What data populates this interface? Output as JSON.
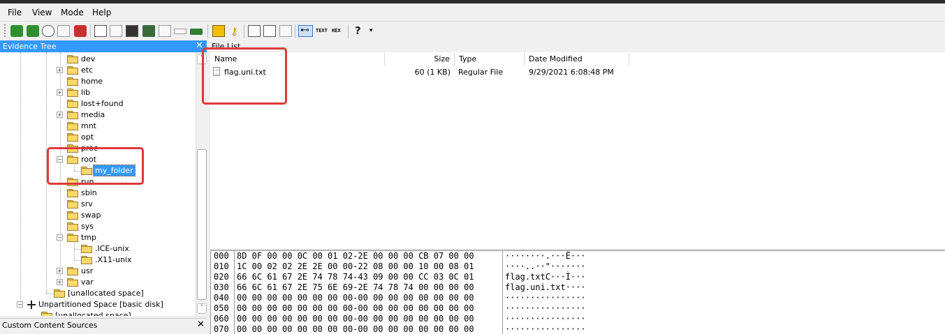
{
  "menu": {
    "file": "File",
    "view": "View",
    "mode": "Mode",
    "help": "Help"
  },
  "toolbar": {
    "text_view": "TEXT",
    "hex_view": "HEX"
  },
  "evidence_tree": {
    "title": "Evidence  Tree",
    "close": "✕",
    "items": [
      {
        "label": "dev"
      },
      {
        "label": "etc"
      },
      {
        "label": "home"
      },
      {
        "label": "lib"
      },
      {
        "label": "lost+found"
      },
      {
        "label": "media"
      },
      {
        "label": "mnt"
      },
      {
        "label": "opt"
      },
      {
        "label": "proc"
      },
      {
        "label": "root"
      },
      {
        "label": "my_folder"
      },
      {
        "label": "run"
      },
      {
        "label": "sbin"
      },
      {
        "label": "srv"
      },
      {
        "label": "swap"
      },
      {
        "label": "sys"
      },
      {
        "label": "tmp"
      },
      {
        "label": ".ICE-unix"
      },
      {
        "label": ".X11-unix"
      },
      {
        "label": "usr"
      },
      {
        "label": "var"
      },
      {
        "label": "[unallocated space]"
      },
      {
        "label": "Unpartitioned Space [basic disk]"
      },
      {
        "label": "[unallocated space]"
      }
    ]
  },
  "custom_content": {
    "title": "Custom Content  Sources",
    "close": "✕"
  },
  "file_list": {
    "title": "File List",
    "columns": {
      "name": "Name",
      "size": "Size",
      "type": "Type",
      "modified": "Date Modified"
    },
    "rows": [
      {
        "name": "flag.uni.txt",
        "size": "60 (1 KB)",
        "type": "Regular File",
        "modified": "9/29/2021 6:08:48 PM"
      }
    ]
  },
  "hex_view": {
    "rows": [
      {
        "offset": "000",
        "bytes": "8D 0F 00 00 0C 00 01 02-2E 00 00 00 CB 07 00 00",
        "ascii": "········.···Ë···"
      },
      {
        "offset": "010",
        "bytes": "1C 00 02 02 2E 2E 00 00-22 08 00 00 10 00 08 01",
        "ascii": "····..··\"·······"
      },
      {
        "offset": "020",
        "bytes": "66 6C 61 67 2E 74 78 74-43 09 00 00 CC 03 0C 01",
        "ascii": "flag.txtC···Ì···"
      },
      {
        "offset": "030",
        "bytes": "66 6C 61 67 2E 75 6E 69-2E 74 78 74 00 00 00 00",
        "ascii": "flag.uni.txt····"
      },
      {
        "offset": "040",
        "bytes": "00 00 00 00 00 00 00 00-00 00 00 00 00 00 00 00",
        "ascii": "················"
      },
      {
        "offset": "050",
        "bytes": "00 00 00 00 00 00 00 00-00 00 00 00 00 00 00 00",
        "ascii": "················"
      },
      {
        "offset": "060",
        "bytes": "00 00 00 00 00 00 00 00-00 00 00 00 00 00 00 00",
        "ascii": "················"
      },
      {
        "offset": "070",
        "bytes": "00 00 00 00 00 00 00 00-00 00 00 00 00 00 00 00",
        "ascii": "················"
      }
    ]
  },
  "colors": {
    "accent": "#3399ff",
    "highlight": "#e0373b"
  }
}
